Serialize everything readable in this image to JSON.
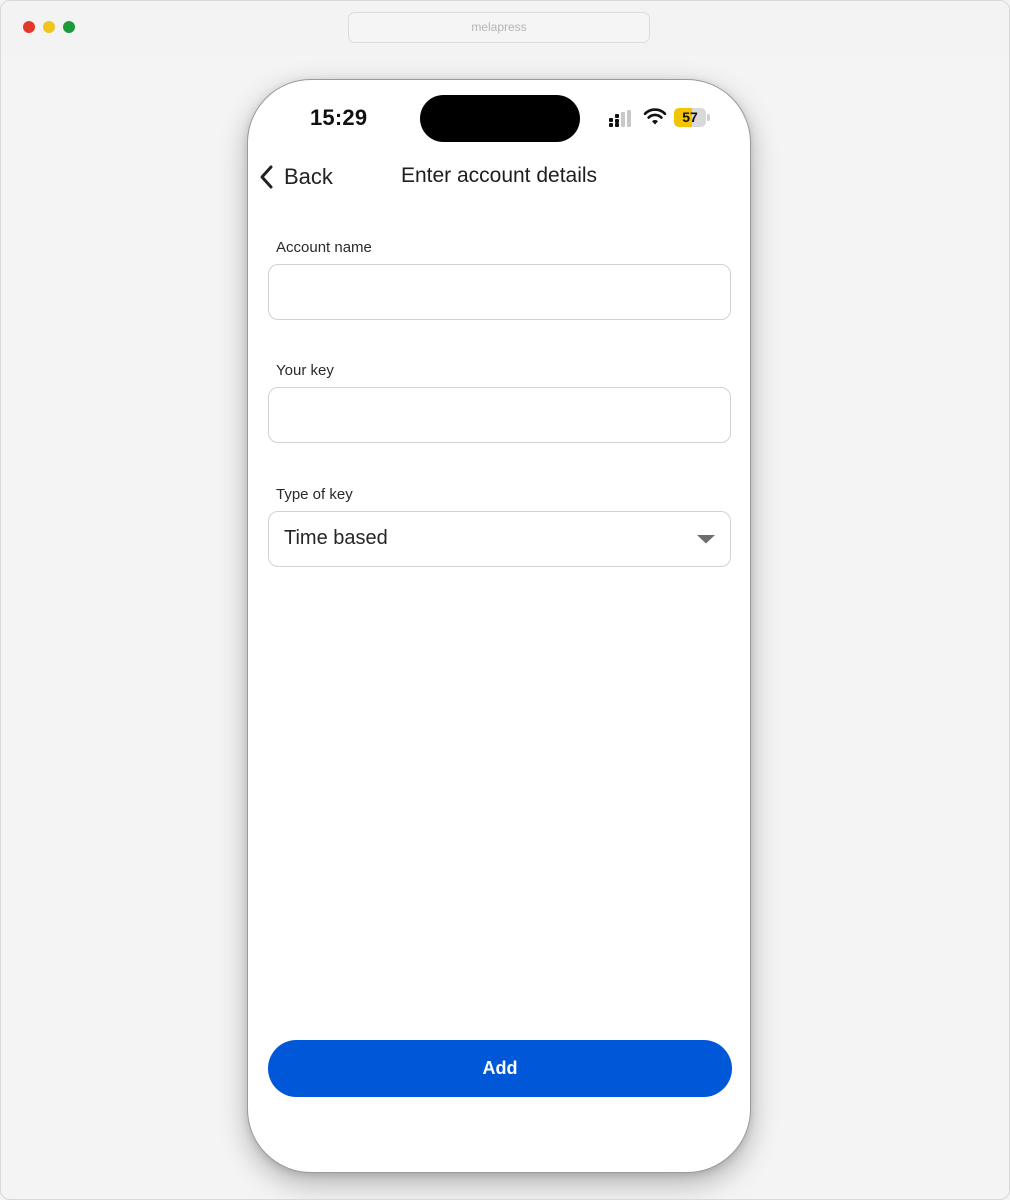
{
  "browser": {
    "url": "melapress"
  },
  "status_bar": {
    "time": "15:29",
    "battery_level": "57",
    "battery_fraction": 0.57,
    "battery_color": "#f5c400"
  },
  "nav": {
    "back_label": "Back",
    "title": "Enter account details"
  },
  "form": {
    "account_name": {
      "label": "Account name",
      "value": "",
      "placeholder": ""
    },
    "your_key": {
      "label": "Your key",
      "value": "",
      "placeholder": ""
    },
    "type_of_key": {
      "label": "Type of key",
      "selected": "Time based"
    }
  },
  "actions": {
    "add_label": "Add",
    "accent_color": "#0058d9"
  }
}
